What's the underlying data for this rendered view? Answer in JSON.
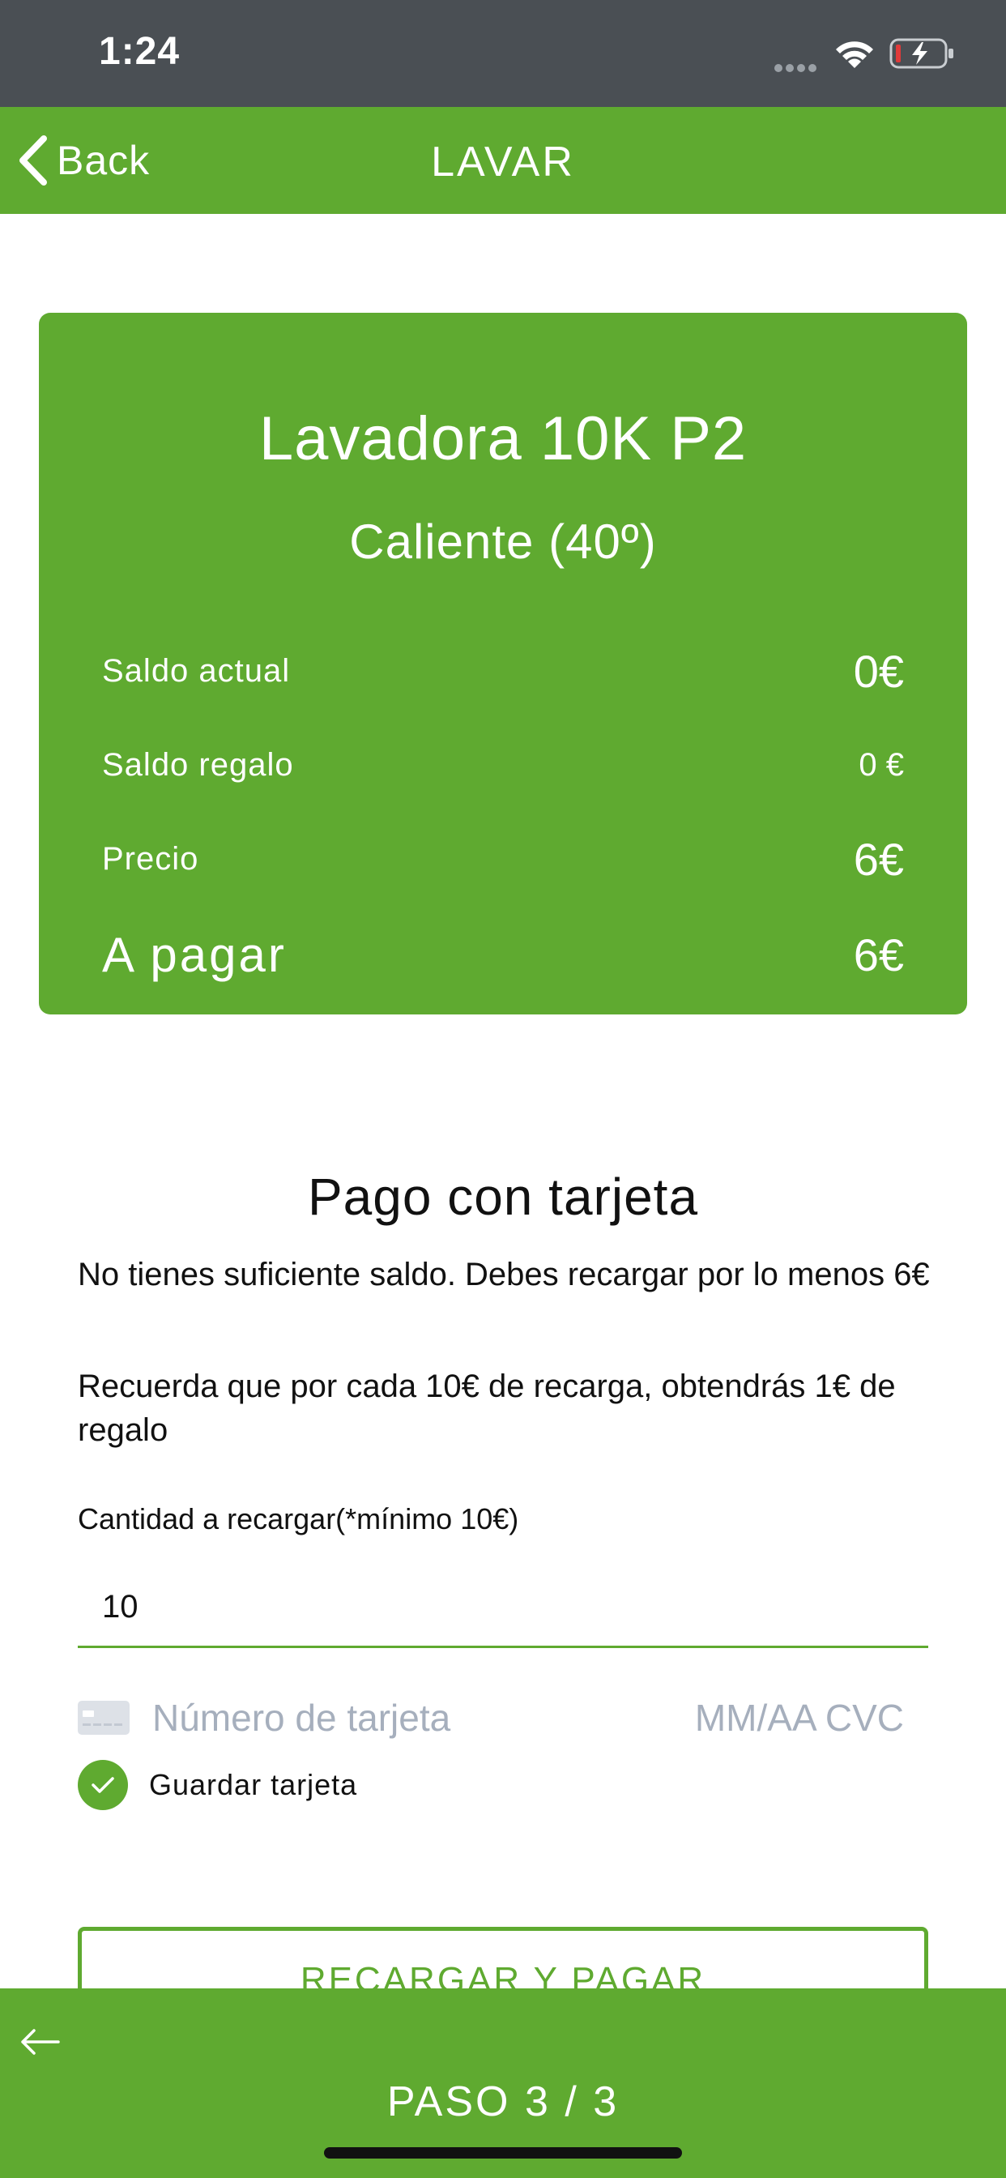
{
  "status_bar": {
    "time": "1:24",
    "icons": [
      "signal-dots-icon",
      "wifi-icon",
      "battery-charging-icon"
    ]
  },
  "nav": {
    "back_label": "Back",
    "title": "LAVAR"
  },
  "summary": {
    "machine": "Lavadora 10K P2",
    "program": "Caliente (40º)",
    "rows": [
      {
        "label": "Saldo actual",
        "value": "0€"
      },
      {
        "label": "Saldo regalo",
        "value": "0 €"
      },
      {
        "label": "Precio",
        "value": "6€"
      },
      {
        "label": "A pagar",
        "value": "6€"
      }
    ]
  },
  "payment": {
    "title": "Pago con tarjeta",
    "note_balance": "No tienes suficiente saldo. Debes recargar por lo menos 6€",
    "note_gift": "Recuerda que por cada 10€ de recarga, obtendrás 1€ de regalo",
    "amount_label": "Cantidad a recargar(*mínimo 10€)",
    "amount_value": "10",
    "card_number_placeholder": "Número de tarjeta",
    "card_exp_placeholder": "MM/AA CVC",
    "save_card_label": "Guardar tarjeta",
    "save_card_checked": true,
    "pay_button_label": "RECARGAR Y PAGAR"
  },
  "bottom_bar": {
    "step_label": "PASO 3 / 3"
  },
  "colors": {
    "brand_green": "#5faa30",
    "status_bar": "#4a4f54",
    "placeholder": "#a6afbd"
  }
}
